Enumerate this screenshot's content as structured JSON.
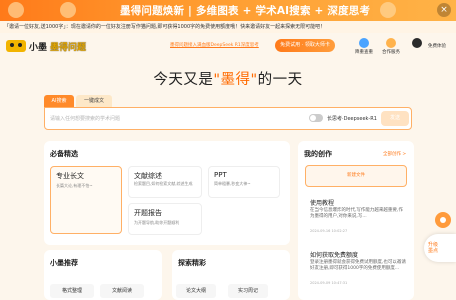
{
  "banner": {
    "text": "墨得问题焕新 | 多维图表 + 学术AI搜索 + 深度思考",
    "close": "×"
  },
  "notice": "「邀请一位好友,送1000字」：现在邀请你的一位好友注册写作猫问题,即可获得1000字的免费使用额度哦！快来邀请好友一起来探索无限可能吧！",
  "header": {
    "logo_text": "小墨",
    "logo_text2": "墨得问题",
    "link": "墨得问题接入满血版DeepSeek R1深度思考",
    "cta": "免费试用 · 领取大师卡",
    "icons": [
      {
        "label": "降重查重",
        "icon": "shield-icon",
        "color": "#4aa3ff"
      },
      {
        "label": "合作服务",
        "icon": "gift-icon",
        "color": "#ffb34d"
      },
      {
        "label": "免费体验",
        "icon": "avatar-icon",
        "color": "#2b2b2b"
      }
    ]
  },
  "hero": {
    "prefix": "今天又是",
    "highlight": "\"墨得\"",
    "suffix": "的一天"
  },
  "tabs": {
    "ai_search": "AI搜索",
    "one_click": "一键成文"
  },
  "search": {
    "placeholder": "请输入任何想要搜索的学术问题",
    "toggle_label": "长思考·Deepseek-R1",
    "send": "发送"
  },
  "essentials": {
    "title": "必备精选",
    "cards": [
      {
        "title": "专业长文",
        "desc": "长篇大论,有理不怕~"
      },
      {
        "title": "文献综述",
        "desc": "检索题目,如何检索文献,综述生成"
      },
      {
        "title": "PPT",
        "desc": "简单粗暴,秒变大神~"
      },
      {
        "title": "开题报告",
        "desc": "为开题导航,助你开题顺利"
      }
    ]
  },
  "recommend": {
    "title": "小墨推荐",
    "items": [
      "格式整理",
      "文献阅读"
    ]
  },
  "explore": {
    "title": "探索精彩",
    "items": [
      "论文大纲",
      "实习周记"
    ]
  },
  "sidebar": {
    "title": "我的创作",
    "link": "全部创作 >",
    "new_file": "新建文件",
    "items": [
      {
        "title": "使用教程",
        "desc": "在当今信息爆炸的时代,写作能力越来越重要,作为墨得的用户,对你来说,写...",
        "date": "2024-09-16 10:02:27"
      },
      {
        "title": "如何获取免费额度",
        "desc": "登录注册墨得就会获得免费试用额度,也可以邀请好友注册,即可获得1000字的免费使用额度...",
        "date": "2024-09-09 10:47:31"
      }
    ]
  },
  "floating": {
    "help": "升级\n墨点"
  },
  "colors": {
    "accent": "#ff7a1a",
    "background": "#fdf6ec"
  }
}
